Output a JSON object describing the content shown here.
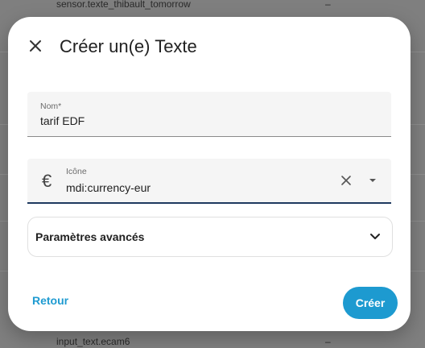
{
  "background": {
    "top_row_text": "sensor.texte_thibault_tomorrow",
    "top_row_value": "–",
    "bottom_row_text": "input_text.ecam6",
    "bottom_row_value": "–"
  },
  "dialog": {
    "title": "Créer un(e) Texte",
    "close_icon": "close-icon",
    "name_field": {
      "label": "Nom*",
      "value": "tarif EDF"
    },
    "icon_field": {
      "label": "Icône",
      "value": "mdi:currency-eur",
      "prefix_glyph": "€"
    },
    "advanced": {
      "label": "Paramètres avancés"
    },
    "back_label": "Retour",
    "create_label": "Créer"
  },
  "colors": {
    "accent": "#1d9ad0",
    "focus_underline": "#1e3a5f"
  }
}
